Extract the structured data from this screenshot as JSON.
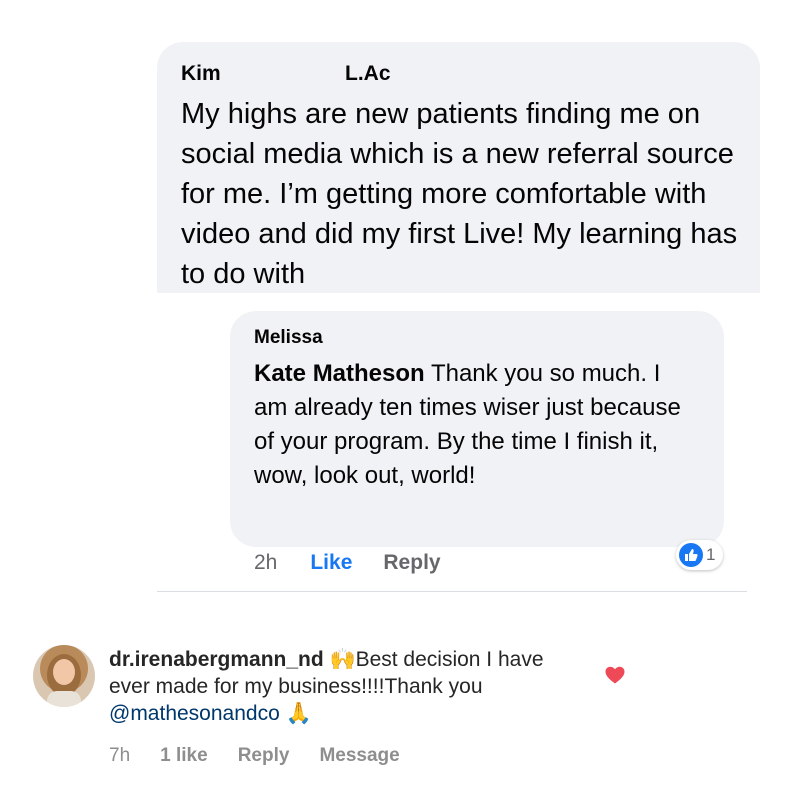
{
  "comment1": {
    "author_first": "Kim",
    "author_second": "L.Ac",
    "text": "My highs are new patients finding me on social media which is a new referral source for me. I’m getting more comfortable with video and did my first Live! My learning has to do with"
  },
  "comment2": {
    "author": "Melissa",
    "tag": "Kate Matheson",
    "text": " Thank you so much. I am already ten times wiser just because of your program. By the time I finish it, wow, look out, world!",
    "time": "2h",
    "like_label": "Like",
    "reply_label": "Reply",
    "reaction_count": "1",
    "colors": {
      "bubble": "#f0f2f5",
      "link": "#1877f2"
    }
  },
  "ig_comment": {
    "username": "dr.irenabergmann_nd",
    "emoji_start": "🙌",
    "text_1": "Best decision I have ever made for my business!!!!Thank you ",
    "mention": "@mathesonandco",
    "emoji_end": "🙏",
    "time": "7h",
    "likes": "1 like",
    "reply_label": "Reply",
    "message_label": "Message",
    "heart_color": "#ed4956"
  }
}
